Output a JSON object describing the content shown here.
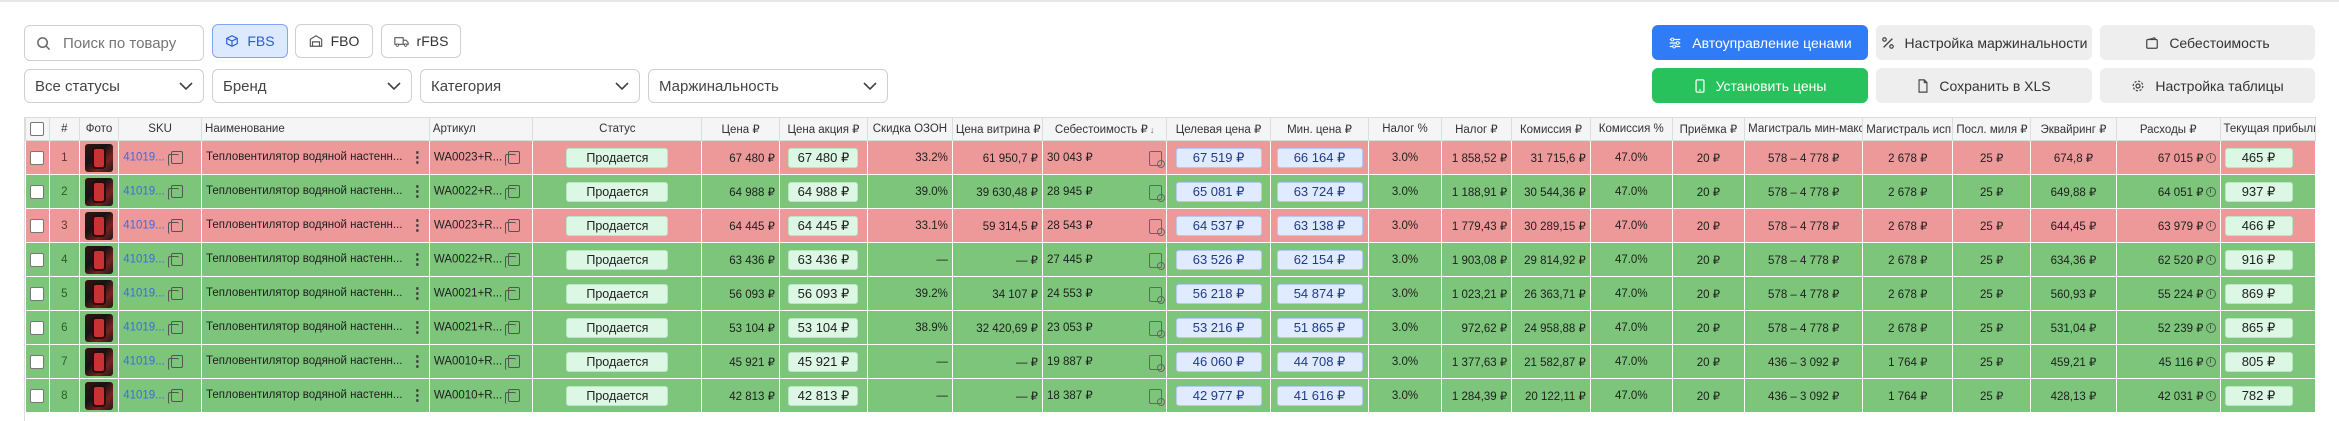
{
  "toolbar": {
    "search_placeholder": "Поиск по товару",
    "channels": [
      "FBS",
      "FBO",
      "rFBS"
    ],
    "active_channel": "FBS",
    "filters": [
      "Все статусы",
      "Бренд",
      "Категория",
      "Маржинальность"
    ],
    "buttons": {
      "auto_prices": "Автоуправление ценами",
      "margin_settings": "Настройка маржинальности",
      "cost": "Себестоимость",
      "set_prices": "Установить цены",
      "save_xls": "Сохранить в XLS",
      "table_settings": "Настройка таблицы"
    }
  },
  "colors": {
    "primary": "#2f7cf6",
    "success": "#27c25c",
    "row_red": "#ee9999",
    "row_green": "#7cc57b"
  },
  "table": {
    "headers": [
      "",
      "#",
      "Фото",
      "SKU",
      "Наименование",
      "Артикул",
      "Статус",
      "Цена ₽",
      "Цена акция ₽",
      "Скидка ОЗОН",
      "Цена витрина ₽",
      "Себестоимость ₽",
      "Целевая цена ₽",
      "Мин. цена ₽",
      "Налог %",
      "Налог ₽",
      "Комиссия ₽",
      "Комиссия %",
      "Приёмка ₽",
      "Магистраль мин-макс",
      "Магистраль исп. ₽",
      "Посл. миля ₽",
      "Эквайринг ₽",
      "Расходы ₽",
      "Текущая прибыль"
    ],
    "rows": [
      {
        "idx": "1",
        "tone": "red",
        "sku": "41019...",
        "name": "Тепловентилятор водяной настенн...",
        "art": "WA0023+R...",
        "status": "Продается",
        "price": "67 480 ₽",
        "promo": "67 480 ₽",
        "disc": "33.2%",
        "vitr": "61 950,7 ₽",
        "cost": "30 043 ₽",
        "target": "67 519 ₽",
        "min": "66 164 ₽",
        "taxp": "3.0%",
        "tax": "1 858,52 ₽",
        "comm": "31 715,6 ₽",
        "commp": "47.0%",
        "recv": "20 ₽",
        "mag": "578 – 4 778 ₽",
        "magu": "2 678 ₽",
        "last": "25 ₽",
        "acq": "674,8 ₽",
        "exp": "67 015 ₽",
        "profit": "465 ₽"
      },
      {
        "idx": "2",
        "tone": "green",
        "sku": "41019...",
        "name": "Тепловентилятор водяной настенн...",
        "art": "WA0022+R...",
        "status": "Продается",
        "price": "64 988 ₽",
        "promo": "64 988 ₽",
        "disc": "39.0%",
        "vitr": "39 630,48 ₽",
        "cost": "28 945 ₽",
        "target": "65 081 ₽",
        "min": "63 724 ₽",
        "taxp": "3.0%",
        "tax": "1 188,91 ₽",
        "comm": "30 544,36 ₽",
        "commp": "47.0%",
        "recv": "20 ₽",
        "mag": "578 – 4 778 ₽",
        "magu": "2 678 ₽",
        "last": "25 ₽",
        "acq": "649,88 ₽",
        "exp": "64 051 ₽",
        "profit": "937 ₽"
      },
      {
        "idx": "3",
        "tone": "red",
        "sku": "41019...",
        "name": "Тепловентилятор водяной настенн...",
        "art": "WA0023+R...",
        "status": "Продается",
        "price": "64 445 ₽",
        "promo": "64 445 ₽",
        "disc": "33.1%",
        "vitr": "59 314,5 ₽",
        "cost": "28 543 ₽",
        "target": "64 537 ₽",
        "min": "63 138 ₽",
        "taxp": "3.0%",
        "tax": "1 779,43 ₽",
        "comm": "30 289,15 ₽",
        "commp": "47.0%",
        "recv": "20 ₽",
        "mag": "578 – 4 778 ₽",
        "magu": "2 678 ₽",
        "last": "25 ₽",
        "acq": "644,45 ₽",
        "exp": "63 979 ₽",
        "profit": "466 ₽"
      },
      {
        "idx": "4",
        "tone": "green",
        "sku": "41019...",
        "name": "Тепловентилятор водяной настенн...",
        "art": "WA0022+R...",
        "status": "Продается",
        "price": "63 436 ₽",
        "promo": "63 436 ₽",
        "disc": "—",
        "vitr": "— ₽",
        "cost": "27 445 ₽",
        "target": "63 526 ₽",
        "min": "62 154 ₽",
        "taxp": "3.0%",
        "tax": "1 903,08 ₽",
        "comm": "29 814,92 ₽",
        "commp": "47.0%",
        "recv": "20 ₽",
        "mag": "578 – 4 778 ₽",
        "magu": "2 678 ₽",
        "last": "25 ₽",
        "acq": "634,36 ₽",
        "exp": "62 520 ₽",
        "profit": "916 ₽"
      },
      {
        "idx": "5",
        "tone": "green",
        "sku": "41019...",
        "name": "Тепловентилятор водяной настенн...",
        "art": "WA0021+R...",
        "status": "Продается",
        "price": "56 093 ₽",
        "promo": "56 093 ₽",
        "disc": "39.2%",
        "vitr": "34 107 ₽",
        "cost": "24 553 ₽",
        "target": "56 218 ₽",
        "min": "54 874 ₽",
        "taxp": "3.0%",
        "tax": "1 023,21 ₽",
        "comm": "26 363,71 ₽",
        "commp": "47.0%",
        "recv": "20 ₽",
        "mag": "578 – 4 778 ₽",
        "magu": "2 678 ₽",
        "last": "25 ₽",
        "acq": "560,93 ₽",
        "exp": "55 224 ₽",
        "profit": "869 ₽"
      },
      {
        "idx": "6",
        "tone": "green",
        "sku": "41019...",
        "name": "Тепловентилятор водяной настенн...",
        "art": "WA0021+R...",
        "status": "Продается",
        "price": "53 104 ₽",
        "promo": "53 104 ₽",
        "disc": "38.9%",
        "vitr": "32 420,69 ₽",
        "cost": "23 053 ₽",
        "target": "53 216 ₽",
        "min": "51 865 ₽",
        "taxp": "3.0%",
        "tax": "972,62 ₽",
        "comm": "24 958,88 ₽",
        "commp": "47.0%",
        "recv": "20 ₽",
        "mag": "578 – 4 778 ₽",
        "magu": "2 678 ₽",
        "last": "25 ₽",
        "acq": "531,04 ₽",
        "exp": "52 239 ₽",
        "profit": "865 ₽"
      },
      {
        "idx": "7",
        "tone": "green",
        "sku": "41019...",
        "name": "Тепловентилятор водяной настенн...",
        "art": "WA0010+R...",
        "status": "Продается",
        "price": "45 921 ₽",
        "promo": "45 921 ₽",
        "disc": "—",
        "vitr": "— ₽",
        "cost": "19 887 ₽",
        "target": "46 060 ₽",
        "min": "44 708 ₽",
        "taxp": "3.0%",
        "tax": "1 377,63 ₽",
        "comm": "21 582,87 ₽",
        "commp": "47.0%",
        "recv": "20 ₽",
        "mag": "436 – 3 092 ₽",
        "magu": "1 764 ₽",
        "last": "25 ₽",
        "acq": "459,21 ₽",
        "exp": "45 116 ₽",
        "profit": "805 ₽"
      },
      {
        "idx": "8",
        "tone": "green",
        "sku": "41019...",
        "name": "Тепловентилятор водяной настенн...",
        "art": "WA0010+R...",
        "status": "Продается",
        "price": "42 813 ₽",
        "promo": "42 813 ₽",
        "disc": "—",
        "vitr": "— ₽",
        "cost": "18 387 ₽",
        "target": "42 977 ₽",
        "min": "41 616 ₽",
        "taxp": "3.0%",
        "tax": "1 284,39 ₽",
        "comm": "20 122,11 ₽",
        "commp": "47.0%",
        "recv": "20 ₽",
        "mag": "436 – 3 092 ₽",
        "magu": "1 764 ₽",
        "last": "25 ₽",
        "acq": "428,13 ₽",
        "exp": "42 031 ₽",
        "profit": "782 ₽"
      }
    ]
  }
}
